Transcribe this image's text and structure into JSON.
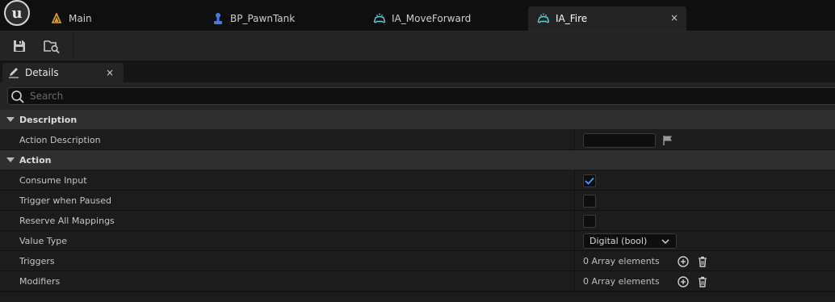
{
  "tabs": [
    {
      "label": "Main",
      "icon": "level-icon",
      "active": false
    },
    {
      "label": "BP_PawnTank",
      "icon": "pawn-icon",
      "active": false
    },
    {
      "label": "IA_MoveForward",
      "icon": "input-action-icon",
      "active": false
    },
    {
      "label": "IA_Fire",
      "icon": "input-action-icon",
      "active": true
    }
  ],
  "toolbar": {
    "save_icon": "save-icon",
    "browse_icon": "browse-asset-icon"
  },
  "panel": {
    "title": "Details",
    "close": "×"
  },
  "search": {
    "placeholder": "Search"
  },
  "categories": {
    "description": {
      "label": "Description",
      "rows": {
        "action_description": {
          "name": "Action Description",
          "value": ""
        }
      }
    },
    "action": {
      "label": "Action",
      "rows": {
        "consume_input": {
          "name": "Consume Input",
          "checked": true
        },
        "trigger_when_paused": {
          "name": "Trigger when Paused",
          "checked": false
        },
        "reserve_all_mappings": {
          "name": "Reserve All Mappings",
          "checked": false
        },
        "value_type": {
          "name": "Value Type",
          "value": "Digital (bool)"
        },
        "triggers": {
          "name": "Triggers",
          "value": "0 Array elements"
        },
        "modifiers": {
          "name": "Modifiers",
          "value": "0 Array elements"
        }
      }
    }
  },
  "colors": {
    "accent": "#4a9bff",
    "level_icon": "#e0a030",
    "pawn_icon": "#4a78e0",
    "input_action_icon": "#5fd0d8"
  }
}
